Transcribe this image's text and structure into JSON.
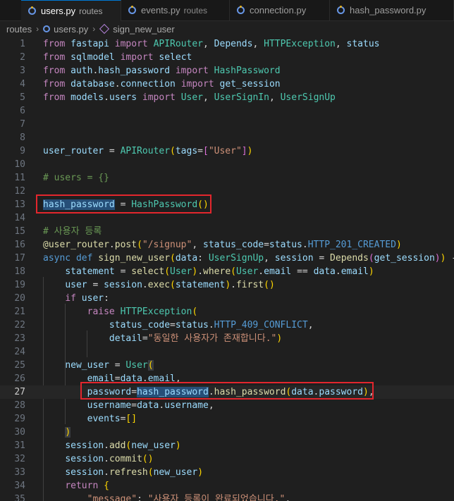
{
  "tabs": [
    {
      "file": "users.py",
      "dir": "routes",
      "active": true
    },
    {
      "file": "events.py",
      "dir": "routes",
      "active": false
    },
    {
      "file": "connection.py",
      "dir": "",
      "active": false
    },
    {
      "file": "hash_password.py",
      "dir": "",
      "active": false
    }
  ],
  "breadcrumb": {
    "folder": "routes",
    "file": "users.py",
    "symbol": "sign_new_user"
  },
  "editor": {
    "current_line": 27,
    "lines": [
      {
        "n": "1",
        "text": "from fastapi import APIRouter, Depends, HTTPException, status"
      },
      {
        "n": "2",
        "text": "from sqlmodel import select"
      },
      {
        "n": "3",
        "text": "from auth.hash_password import HashPassword"
      },
      {
        "n": "4",
        "text": "from database.connection import get_session"
      },
      {
        "n": "5",
        "text": "from models.users import User, UserSignIn, UserSignUp"
      },
      {
        "n": "6",
        "text": ""
      },
      {
        "n": "7",
        "text": ""
      },
      {
        "n": "8",
        "text": ""
      },
      {
        "n": "9",
        "text": "user_router = APIRouter(tags=[\"User\"])"
      },
      {
        "n": "10",
        "text": ""
      },
      {
        "n": "11",
        "text": "# users = {}"
      },
      {
        "n": "12",
        "text": ""
      },
      {
        "n": "13",
        "text": "hash_password = HashPassword()"
      },
      {
        "n": "14",
        "text": ""
      },
      {
        "n": "15",
        "text": "# 사용자 등록"
      },
      {
        "n": "16",
        "text": "@user_router.post(\"/signup\", status_code=status.HTTP_201_CREATED)"
      },
      {
        "n": "17",
        "text": "async def sign_new_user(data: UserSignUp, session = Depends(get_session)) -"
      },
      {
        "n": "18",
        "text": "    statement = select(User).where(User.email == data.email)"
      },
      {
        "n": "19",
        "text": "    user = session.exec(statement).first()"
      },
      {
        "n": "20",
        "text": "    if user:"
      },
      {
        "n": "21",
        "text": "        raise HTTPException("
      },
      {
        "n": "22",
        "text": "            status_code=status.HTTP_409_CONFLICT,"
      },
      {
        "n": "23",
        "text": "            detail=\"동일한 사용자가 존재합니다.\")"
      },
      {
        "n": "24",
        "text": ""
      },
      {
        "n": "25",
        "text": "    new_user = User("
      },
      {
        "n": "26",
        "text": "        email=data.email,"
      },
      {
        "n": "27",
        "text": "        password=hash_password.hash_password(data.password),"
      },
      {
        "n": "28",
        "text": "        username=data.username,"
      },
      {
        "n": "29",
        "text": "        events=[]"
      },
      {
        "n": "30",
        "text": "    )"
      },
      {
        "n": "31",
        "text": "    session.add(new_user)"
      },
      {
        "n": "32",
        "text": "    session.commit()"
      },
      {
        "n": "33",
        "text": "    session.refresh(new_user)"
      },
      {
        "n": "34",
        "text": "    return {"
      },
      {
        "n": "35",
        "text": "        \"message\": \"사용자 등록이 완료되었습니다.\","
      }
    ]
  },
  "colors": {
    "background": "#1f1f1f",
    "keyword": "#c586c0",
    "storage": "#569cd6",
    "function": "#dcdcaa",
    "class": "#4ec9b0",
    "variable": "#9cdcfe",
    "string": "#ce9178",
    "comment": "#6a9955",
    "annotation_box": "#e3262d",
    "selection": "#264f78"
  }
}
